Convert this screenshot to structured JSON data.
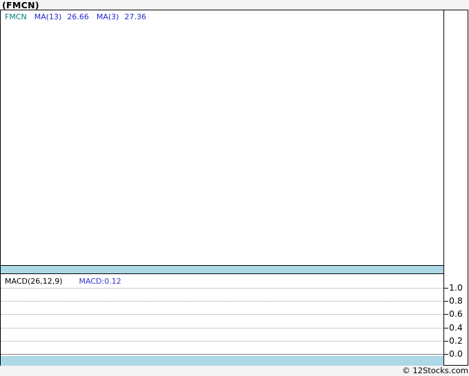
{
  "title": "(FMCN)",
  "price_panel": {
    "legend": {
      "symbol": "FMCN",
      "ma13_label": "MA(13)",
      "ma13_value": "26.66",
      "ma3_label": "MA(3)",
      "ma3_value": "27.36"
    }
  },
  "macd_panel": {
    "legend_label": "MACD(26,12,9)",
    "legend_value": "MACD:0.12"
  },
  "axis": {
    "side": "right",
    "tick_labels": [
      "1.0",
      "0.8",
      "0.6",
      "0.4",
      "0.2",
      "0.0"
    ]
  },
  "footer": {
    "copyright": "© 12Stocks.com"
  },
  "colors": {
    "symbol_text": "#008080",
    "ma_text": "#2424cc",
    "macd_value_text": "#3333cc",
    "band_fill": "#add8e6",
    "grid_dotted": "#999999",
    "zero_line": "#000000",
    "frame_border": "#000000",
    "page_background": "#f4f4f5",
    "panel_background": "#ffffff"
  },
  "chart_data": {
    "type": "line",
    "title": "(FMCN)",
    "axis_side": "right",
    "panels": [
      {
        "name": "price",
        "indicators": [
          {
            "name": "MA(13)",
            "value": 26.66
          },
          {
            "name": "MA(3)",
            "value": 27.36
          }
        ],
        "series": [],
        "note": "panel rendered empty - no visible price series"
      },
      {
        "name": "MACD(26,12,9)",
        "indicators": [
          {
            "name": "MACD",
            "value": 0.12
          }
        ],
        "ylim": [
          0.0,
          1.0
        ],
        "y_ticks": [
          1.0,
          0.8,
          0.6,
          0.4,
          0.2,
          0.0
        ],
        "grid": "dotted-horizontal",
        "legend_position": "top-left",
        "series": [],
        "note": "panel rendered empty - no visible MACD series"
      }
    ]
  }
}
